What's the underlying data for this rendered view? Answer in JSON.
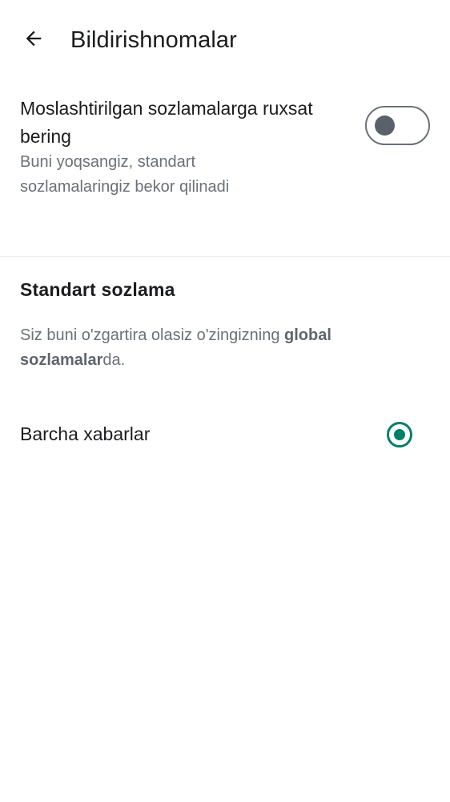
{
  "header": {
    "title": "Bildirishnomalar",
    "back_icon": "arrow-left-icon"
  },
  "custom_settings": {
    "title": "Moslashtirilgan sozlamalarga ruxsat bering",
    "subtitle": "Buni yoqsangiz, standart sozlamalaringiz bekor qilinadi",
    "toggle_on": false
  },
  "default_section": {
    "title": "Standart sozlama",
    "desc_prefix": "Siz buni o'zgartira olasiz o'zingizning ",
    "desc_link": "global sozlamalar",
    "desc_suffix": "da."
  },
  "options": [
    {
      "label": "Barcha xabarlar",
      "selected": true
    }
  ],
  "colors": {
    "accent": "#00806a",
    "text_primary": "#1b1c1e",
    "text_secondary": "#6b7178",
    "divider": "#e8eaec"
  }
}
